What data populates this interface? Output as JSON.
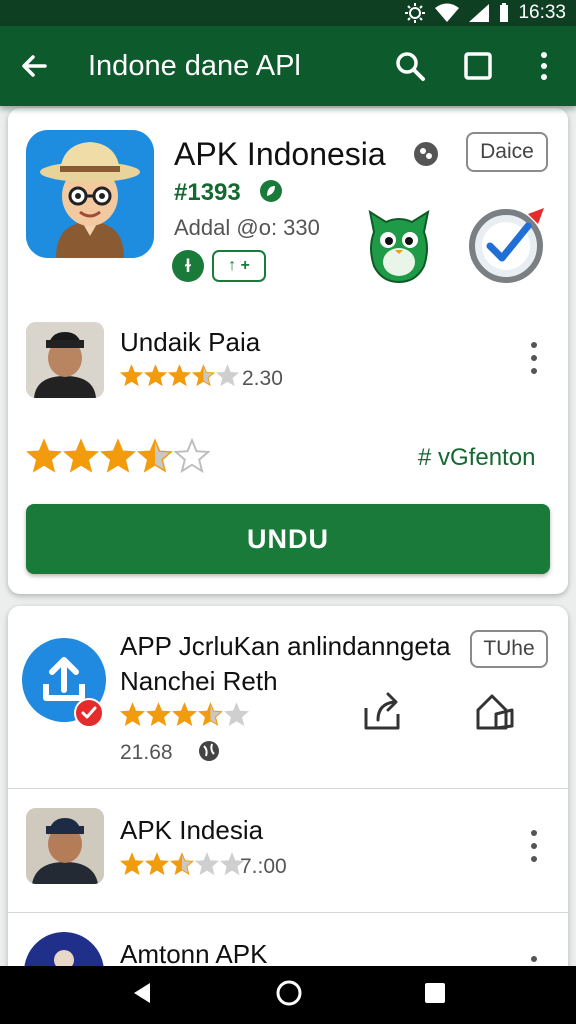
{
  "status_bar": {
    "time": "16:33"
  },
  "app_bar": {
    "title": "Indone dane APl",
    "icons": [
      "back-arrow-icon",
      "search-icon",
      "square-icon",
      "more-vert-icon"
    ]
  },
  "featured": {
    "title": "APK Indonesia",
    "chip": "Daice",
    "tag": "#1393",
    "meta": "Addal @o: 330",
    "badge_round": "ɫ",
    "badge_box": "↑ +",
    "review": {
      "name": "Undaik Paia",
      "stars": 3.5,
      "value": "2.30"
    },
    "rating_stars": 3.5,
    "hashtag": "# vGfenton",
    "install_label": "UNDU"
  },
  "list": [
    {
      "title_line1": "APP JcrluKan anlindanngeta",
      "title_line2": "Nanchei Reth",
      "chip": "TUhe",
      "stars": 3.5,
      "value": "21.68"
    },
    {
      "title": "APK Indesia",
      "stars": 2.5,
      "value": "7.:00"
    },
    {
      "title": "Amtonn APK"
    }
  ],
  "colors": {
    "primary": "#0d5a2c",
    "accent": "#1a7a39",
    "star": "#f29b0c",
    "status": "#0f3f22"
  }
}
